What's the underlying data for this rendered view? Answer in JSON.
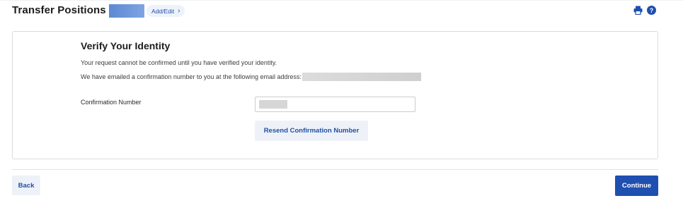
{
  "header": {
    "title": "Transfer Positions",
    "add_edit_label": "Add/Edit",
    "add_edit_icon": "chevron-right-icon",
    "print_icon": "print-icon",
    "help_icon": "help-icon",
    "help_glyph": "?"
  },
  "verify": {
    "heading": "Verify Your Identity",
    "message_unconfirmed": "Your request cannot be confirmed until you have verified your identity.",
    "message_emailed": "We have emailed a confirmation number to you at the following email address:",
    "confirmation_label": "Confirmation Number",
    "resend_label": "Resend Confirmation Number"
  },
  "footer": {
    "back_label": "Back",
    "continue_label": "Continue"
  },
  "colors": {
    "brand_blue": "#1f4fb0",
    "link_blue": "#1f4fa5",
    "secondary_button_bg": "#eef2f8",
    "border": "#d9dce1"
  }
}
